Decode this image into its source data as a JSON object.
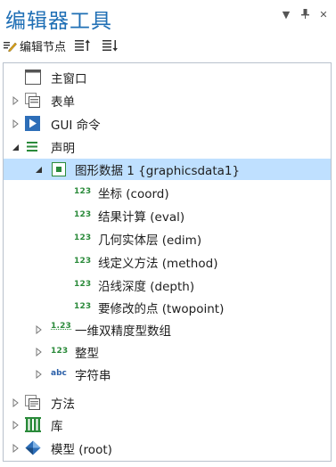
{
  "window": {
    "title": "编辑器工具"
  },
  "toolbar": {
    "edit_node_label": "编辑节点"
  },
  "tree": {
    "items": [
      {
        "label": "主窗口"
      },
      {
        "label": "表单"
      },
      {
        "label": "GUI 命令"
      },
      {
        "label": "声明"
      },
      {
        "label": "图形数据 1 {graphicsdata1}"
      },
      {
        "label": "坐标 (coord)",
        "type_badge": "123"
      },
      {
        "label": "结果计算 (eval)",
        "type_badge": "123"
      },
      {
        "label": "几何实体层 (edim)",
        "type_badge": "123"
      },
      {
        "label": "线定义方法 (method)",
        "type_badge": "123"
      },
      {
        "label": "沿线深度 (depth)",
        "type_badge": "123"
      },
      {
        "label": "要修改的点 (twopoint)",
        "type_badge": "123"
      },
      {
        "label": "一维双精度型数组",
        "type_badge": "1.23"
      },
      {
        "label": "整型",
        "type_badge": "123"
      },
      {
        "label": "字符串",
        "type_badge": "abc"
      },
      {
        "label": "方法"
      },
      {
        "label": "库"
      },
      {
        "label": "模型 (root)"
      }
    ]
  },
  "colors": {
    "title": "#1f6fb5",
    "selection": "#bfe0ff",
    "badge_green": "#2a8a3a"
  }
}
